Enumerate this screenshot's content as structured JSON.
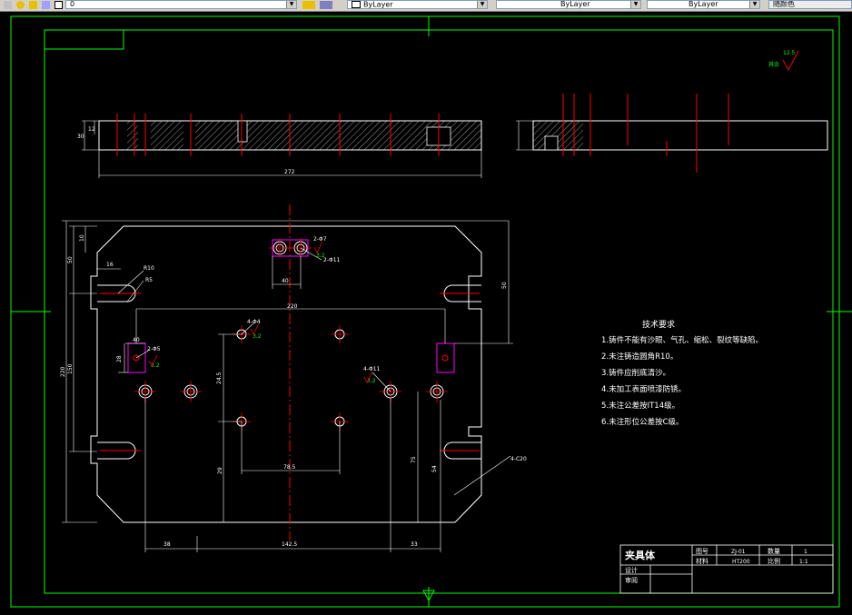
{
  "toolbar": {
    "layer_value": "0",
    "color_value": "ByLayer",
    "linetype_value": "ByLayer",
    "lineweight_value": "ByLayer",
    "plotstyle_value": "随颜色"
  },
  "drawing": {
    "roughness_label": "其余",
    "roughness_value": "12.5",
    "dims": {
      "top_thickness": "30",
      "top_small": "12",
      "top_length": "272",
      "main_height": "220",
      "main_inner_height": "150",
      "main_top_offset": "10",
      "main_slot_offset": "50",
      "main_width_220": "220",
      "slot_r10": "R10",
      "slot_r5": "R5",
      "slot_16": "16",
      "hole_2phi7": "2-Φ7",
      "hole_2phi11": "2-Φ11",
      "hole_4phi4": "4-Φ4",
      "hole_4phi11": "4-Φ11",
      "hole_2phi5": "2-Φ5",
      "dim_40": "40",
      "dim_245": "24.5",
      "dim_28": "28",
      "dim_29": "29",
      "dim_785": "78.5",
      "dim_40b": "40",
      "dim_right_50": "50",
      "dim_75": "75",
      "dim_54": "54",
      "corner_4c20": "4-C20",
      "bottom_38": "38",
      "bottom_1425": "142.5",
      "bottom_33": "33",
      "rough_32": "3.2",
      "rough_32b": "3.2",
      "rough_32c": "3.2",
      "rough_32d": "3.2"
    },
    "requirements_title": "技术要求",
    "requirements": [
      "1.铸件不能有沙眼、气孔、缩松、裂纹等缺陷。",
      "2.未注铸造圆角R10。",
      "3.铸件应削底清沙。",
      "4.未加工表面喷漆防锈。",
      "5.未注公差按IT14级。",
      "6.未注形位公差按C级。"
    ],
    "title_block": {
      "name": "夹具体",
      "label_drawing_no": "图号",
      "drawing_no": "ZJ-01",
      "label_qty": "数量",
      "qty": "1",
      "label_material": "材料",
      "material": "HT200",
      "label_scale": "比例",
      "scale": "1:1",
      "label_design": "设计",
      "label_review": "审阅"
    }
  },
  "colors": {
    "frame": "#00ff00",
    "outline": "#ffffff",
    "center": "#ff0000",
    "hole": "#ff00ff",
    "dim": "#ffffff",
    "rough": "#00ff00"
  }
}
